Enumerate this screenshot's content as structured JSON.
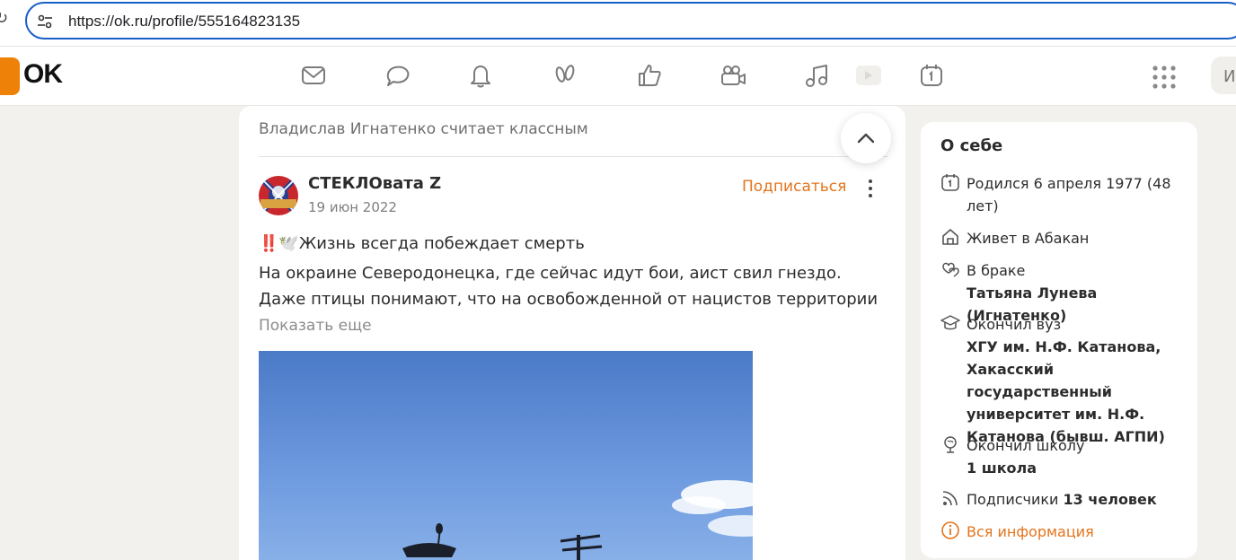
{
  "browser": {
    "url": "https://ok.ru/profile/555164823135"
  },
  "header": {
    "logo_text": "OK",
    "nav_icons": [
      "mail-icon",
      "chat-icon",
      "bell-icon",
      "guests-icon",
      "like-icon",
      "video-camera-icon",
      "music-icon",
      "play-icon",
      "calendar-icon"
    ],
    "search_stub": "И"
  },
  "feed": {
    "liked_by": "Владислав Игнатенко считает классным",
    "post": {
      "author": "СТЕКЛОвата Z",
      "date": "19 июн 2022",
      "subscribe_label": "Подписаться",
      "title_emoji": "‼️🕊️",
      "title": "Жизнь всегда побеждает смерть",
      "body": "На окраине Северодонецка, где сейчас идут бои, аист свил гнездо. Даже птицы понимают, что на освобожденной от нацистов территории",
      "show_more": "Показать еще"
    }
  },
  "about": {
    "title": "О себе",
    "born": "Родился 6 апреля 1977 (48 лет)",
    "lives_prefix": "Живет в ",
    "lives_city": "Абакан",
    "married_label": "В браке",
    "married_to": "Татьяна Лунева (Игнатенко)",
    "university_label": "Окончил вуз",
    "university": "ХГУ им. Н.Ф. Катанова, Хакасский государственный университет им. Н.Ф. Катанова (бывш. АГПИ)",
    "school_label": "Окончил школу",
    "school": "1 школа",
    "followers_label": "Подписчики ",
    "followers_value": "13 человек",
    "all_info": "Вся информация"
  },
  "colors": {
    "accent": "#e3741c",
    "logo": "#ee8208",
    "url_focus": "#1a5fc8"
  }
}
